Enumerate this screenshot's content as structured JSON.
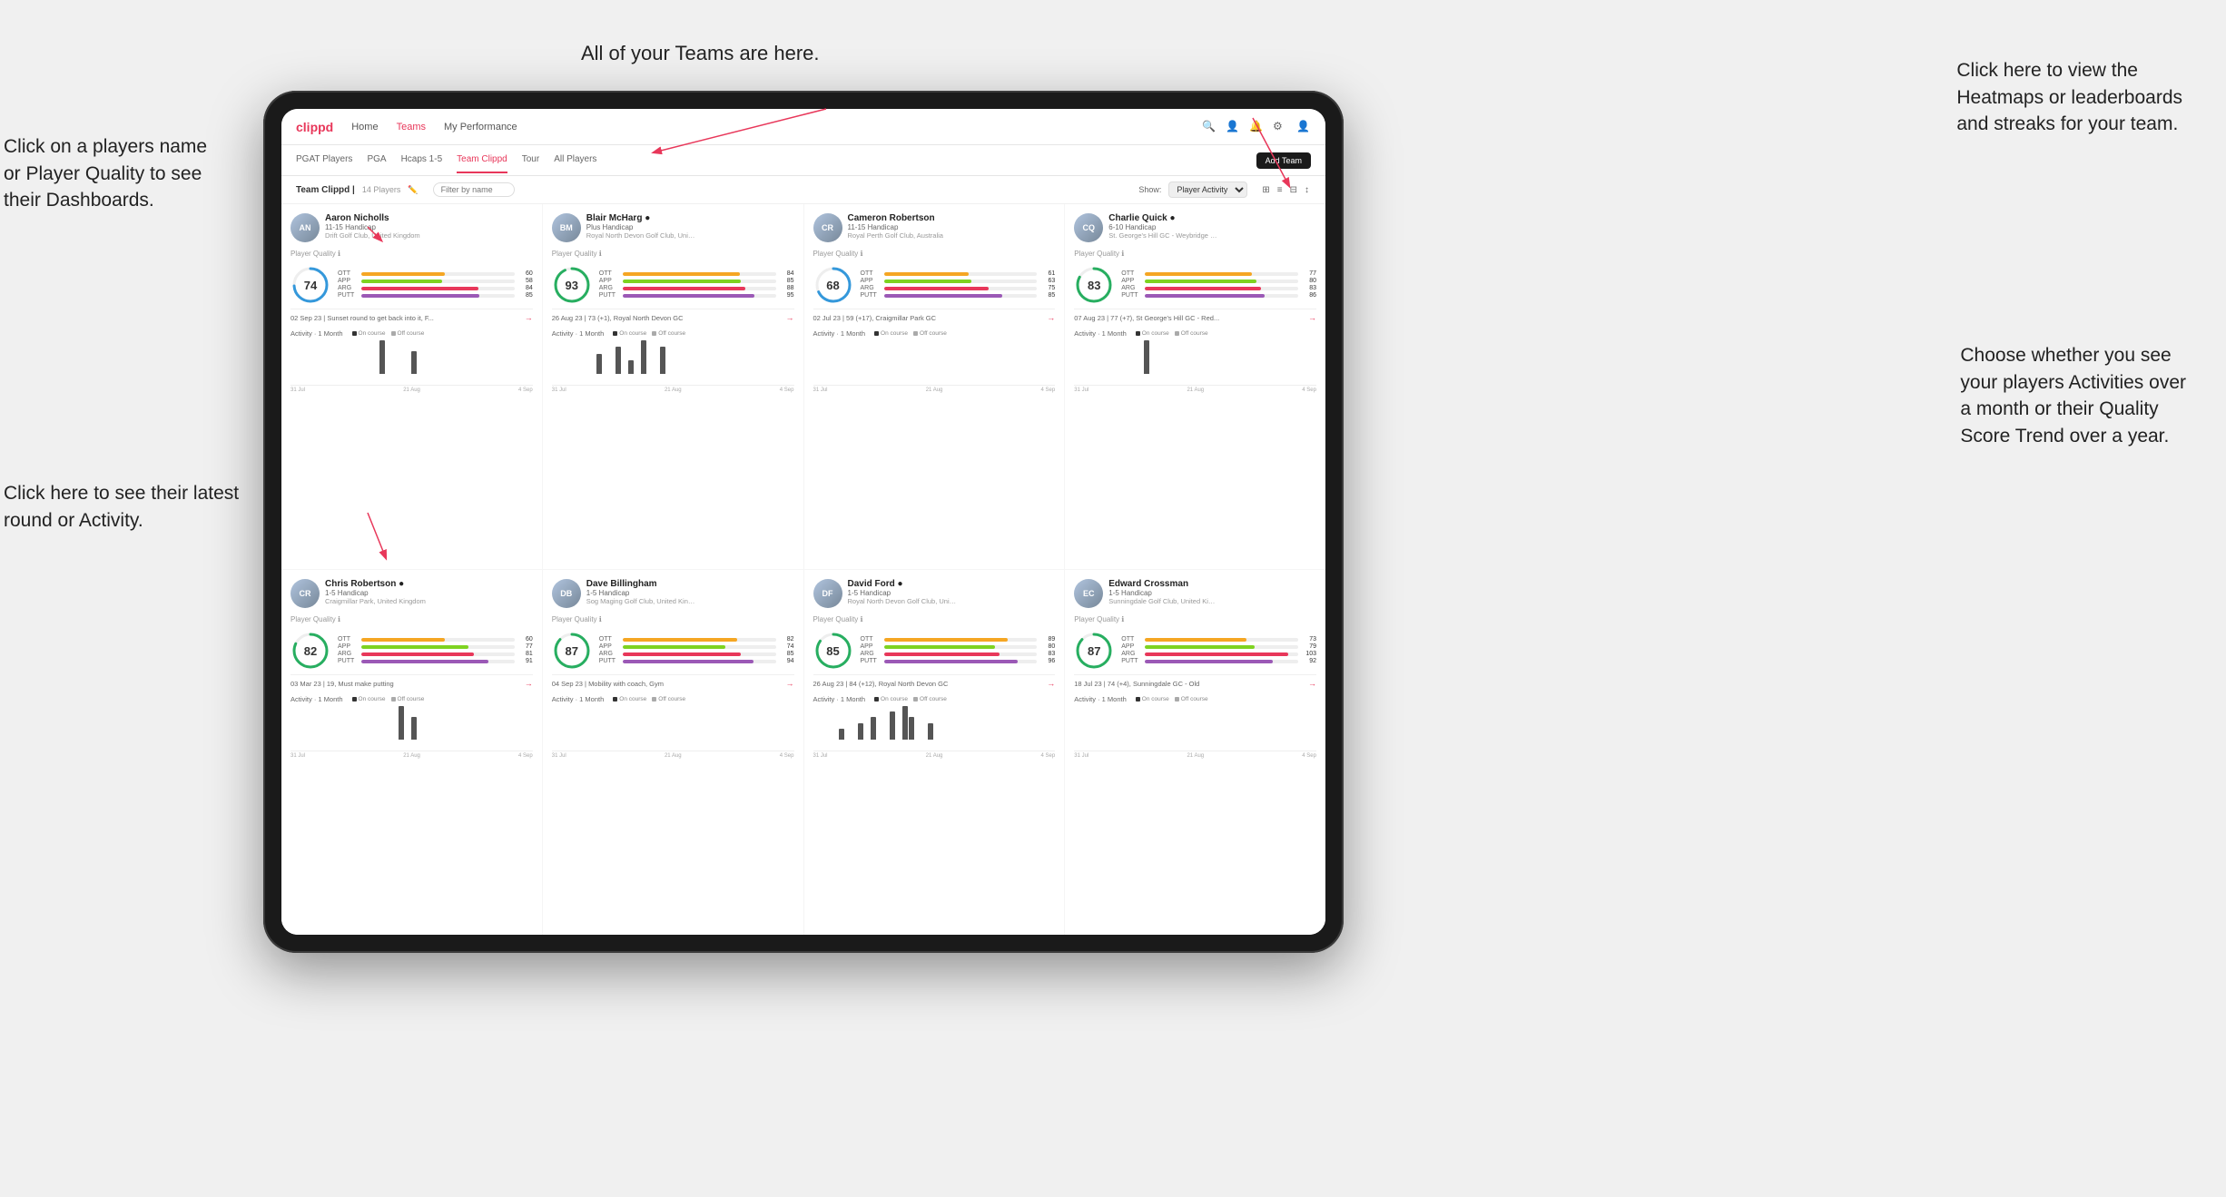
{
  "annotations": {
    "teams_title": "All of your Teams are here.",
    "heatmaps_title": "Click here to view the\nHeatmaps or leaderboards\nand streaks for your team.",
    "players_name": "Click on a players name\nor Player Quality to see\ntheir Dashboards.",
    "latest_round": "Click here to see their latest\nround or Activity.",
    "activities_title": "Choose whether you see\nyour players Activities over\na month or their Quality\nScore Trend over a year."
  },
  "nav": {
    "logo": "clippd",
    "items": [
      "Home",
      "Teams",
      "My Performance"
    ],
    "add_team": "Add Team"
  },
  "sub_tabs": [
    "PGAT Players",
    "PGA",
    "Hcaps 1-5",
    "Team Clippd",
    "Tour",
    "All Players"
  ],
  "active_tab": "Team Clippd",
  "team_header": {
    "title": "Team Clippd",
    "count": "14 Players",
    "show_label": "Show:",
    "show_value": "Player Activity"
  },
  "players": [
    {
      "name": "Aaron Nicholls",
      "handicap": "11-15 Handicap",
      "club": "Drift Golf Club, United Kingdom",
      "quality": 74,
      "ott": 60,
      "app": 58,
      "arg": 84,
      "putt": 85,
      "latest": "02 Sep 23 | Sunset round to get back into it, F...",
      "chart_bars": [
        0,
        0,
        0,
        0,
        0,
        0,
        0,
        0,
        0,
        0,
        0,
        0,
        0,
        0,
        3,
        0,
        0,
        0,
        0,
        2,
        0
      ],
      "dates": [
        "31 Jul",
        "21 Aug",
        "4 Sep"
      ]
    },
    {
      "name": "Blair McHarg",
      "handicap": "Plus Handicap",
      "club": "Royal North Devon Golf Club, United Kin...",
      "quality": 93,
      "ott": 84,
      "app": 85,
      "arg": 88,
      "putt": 95,
      "latest": "26 Aug 23 | 73 (+1), Royal North Devon GC",
      "chart_bars": [
        0,
        0,
        0,
        0,
        0,
        0,
        0,
        3,
        0,
        0,
        4,
        0,
        2,
        0,
        5,
        0,
        0,
        4,
        0,
        0,
        0
      ],
      "dates": [
        "31 Jul",
        "21 Aug",
        "4 Sep"
      ]
    },
    {
      "name": "Cameron Robertson",
      "handicap": "11-15 Handicap",
      "club": "Royal Perth Golf Club, Australia",
      "quality": 68,
      "ott": 61,
      "app": 63,
      "arg": 75,
      "putt": 85,
      "latest": "02 Jul 23 | 59 (+17), Craigmillar Park GC",
      "chart_bars": [
        0,
        0,
        0,
        0,
        0,
        0,
        0,
        0,
        0,
        0,
        0,
        0,
        0,
        0,
        0,
        0,
        0,
        0,
        0,
        0,
        0
      ],
      "dates": [
        "31 Jul",
        "21 Aug",
        "4 Sep"
      ]
    },
    {
      "name": "Charlie Quick",
      "handicap": "6-10 Handicap",
      "club": "St. George's Hill GC - Weybridge - Surrey...",
      "quality": 83,
      "ott": 77,
      "app": 80,
      "arg": 83,
      "putt": 86,
      "latest": "07 Aug 23 | 77 (+7), St George's Hill GC - Red...",
      "chart_bars": [
        0,
        0,
        0,
        0,
        0,
        0,
        0,
        0,
        0,
        0,
        0,
        3,
        0,
        0,
        0,
        0,
        0,
        0,
        0,
        0,
        0
      ],
      "dates": [
        "31 Jul",
        "21 Aug",
        "4 Sep"
      ]
    },
    {
      "name": "Chris Robertson",
      "handicap": "1-5 Handicap",
      "club": "Craigmillar Park, United Kingdom",
      "quality": 82,
      "ott": 60,
      "app": 77,
      "arg": 81,
      "putt": 91,
      "latest": "03 Mar 23 | 19, Must make putting",
      "chart_bars": [
        0,
        0,
        0,
        0,
        0,
        0,
        0,
        0,
        0,
        0,
        0,
        0,
        0,
        0,
        0,
        0,
        0,
        3,
        0,
        2,
        0
      ],
      "dates": [
        "31 Jul",
        "21 Aug",
        "4 Sep"
      ]
    },
    {
      "name": "Dave Billingham",
      "handicap": "1-5 Handicap",
      "club": "Sog Maging Golf Club, United Kingdom",
      "quality": 87,
      "ott": 82,
      "app": 74,
      "arg": 85,
      "putt": 94,
      "latest": "04 Sep 23 | Mobility with coach, Gym",
      "chart_bars": [
        0,
        0,
        0,
        0,
        0,
        0,
        0,
        0,
        0,
        0,
        0,
        0,
        0,
        0,
        0,
        0,
        0,
        0,
        0,
        0,
        0
      ],
      "dates": [
        "31 Jul",
        "21 Aug",
        "4 Sep"
      ]
    },
    {
      "name": "David Ford",
      "handicap": "1-5 Handicap",
      "club": "Royal North Devon Golf Club, United Kni...",
      "quality": 85,
      "ott": 89,
      "app": 80,
      "arg": 83,
      "putt": 96,
      "latest": "26 Aug 23 | 84 (+12), Royal North Devon GC",
      "chart_bars": [
        0,
        0,
        0,
        0,
        2,
        0,
        0,
        3,
        0,
        4,
        0,
        0,
        5,
        0,
        6,
        4,
        0,
        0,
        3,
        0,
        0
      ],
      "dates": [
        "31 Jul",
        "21 Aug",
        "4 Sep"
      ]
    },
    {
      "name": "Edward Crossman",
      "handicap": "1-5 Handicap",
      "club": "Sunningdale Golf Club, United Kingdom",
      "quality": 87,
      "ott": 73,
      "app": 79,
      "arg": 103,
      "putt": 92,
      "latest": "18 Jul 23 | 74 (+4), Sunningdale GC - Old",
      "chart_bars": [
        0,
        0,
        0,
        0,
        0,
        0,
        0,
        0,
        0,
        0,
        0,
        0,
        0,
        0,
        0,
        0,
        0,
        0,
        0,
        0,
        0
      ],
      "dates": [
        "31 Jul",
        "21 Aug",
        "4 Sep"
      ]
    }
  ],
  "colors": {
    "brand": "#e8375a",
    "ott": "#f5a623",
    "app": "#7ed321",
    "arg": "#e8375a",
    "putt": "#9b59b6",
    "circle_74": "#3498db",
    "circle_93": "#27ae60",
    "circle_68": "#3498db",
    "circle_83": "#27ae60",
    "circle_82": "#27ae60",
    "circle_87": "#27ae60",
    "circle_85": "#27ae60"
  }
}
